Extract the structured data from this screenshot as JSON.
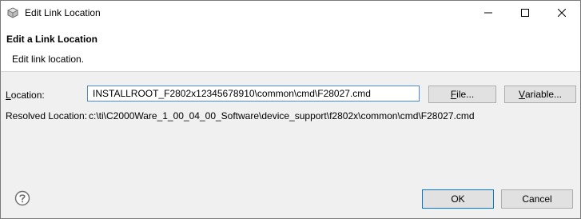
{
  "window": {
    "title": "Edit Link Location",
    "icon": "eclipse-app-icon"
  },
  "banner": {
    "title": "Edit a Link Location",
    "description": "Edit link location."
  },
  "form": {
    "location_label_prefix": "L",
    "location_label_rest": "ocation:",
    "location_value": "INSTALLROOT_F2802x12345678910\\common\\cmd\\F28027.cmd",
    "file_button_prefix": "F",
    "file_button_rest": "ile...",
    "variable_button_prefix": "V",
    "variable_button_rest": "ariable...",
    "resolved_label": "Resolved Location:",
    "resolved_value": "c:\\ti\\C2000Ware_1_00_04_00_Software\\device_support\\f2802x\\common\\cmd\\F28027.cmd"
  },
  "footer": {
    "ok_label": "OK",
    "cancel_label": "Cancel",
    "help_icon": "help-icon"
  }
}
